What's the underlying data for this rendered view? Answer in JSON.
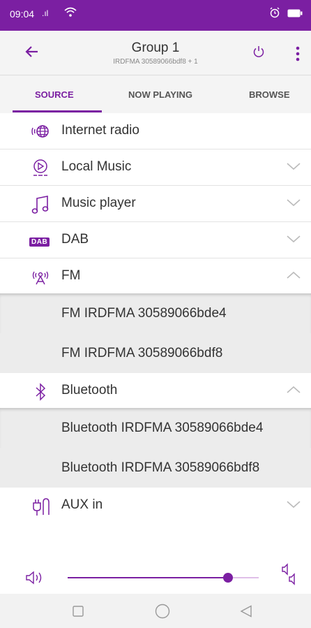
{
  "status": {
    "time": "09:04",
    "signal": ".ıl"
  },
  "appbar": {
    "title": "Group 1",
    "subtitle": "IRDFMA 30589066bdf8 + 1"
  },
  "tabs": [
    {
      "label": "SOURCE"
    },
    {
      "label": "NOW PLAYING"
    },
    {
      "label": "BROWSE"
    }
  ],
  "sources": [
    {
      "label": "Internet radio",
      "icon": "globe-radio-icon",
      "chevron": "none"
    },
    {
      "label": "Local Music",
      "icon": "local-music-icon",
      "chevron": "down"
    },
    {
      "label": "Music player",
      "icon": "music-note-icon",
      "chevron": "down"
    },
    {
      "label": "DAB",
      "icon": "dab-icon",
      "chevron": "down"
    },
    {
      "label": "FM",
      "icon": "fm-radio-icon",
      "chevron": "up"
    },
    {
      "label": "Bluetooth",
      "icon": "bluetooth-icon",
      "chevron": "up"
    },
    {
      "label": "AUX in",
      "icon": "aux-plug-icon",
      "chevron": "down"
    }
  ],
  "fm_devices": [
    "FM IRDFMA 30589066bde4",
    "FM IRDFMA 30589066bdf8"
  ],
  "bluetooth_devices": [
    "Bluetooth IRDFMA 30589066bde4",
    "Bluetooth IRDFMA 30589066bdf8"
  ],
  "dab_icon_text": "DAB",
  "volume": {
    "level": 0.84
  },
  "colors": {
    "accent": "#7b1fa2",
    "statusbar": "#7b1fa2"
  }
}
